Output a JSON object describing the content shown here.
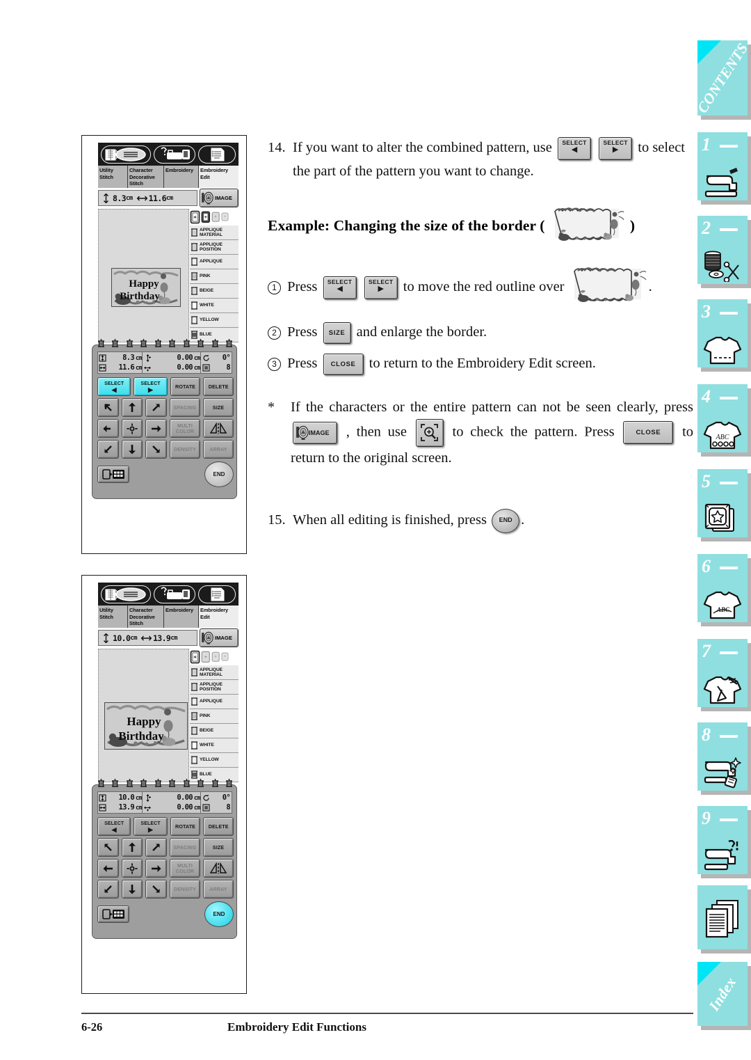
{
  "document": {
    "footer": {
      "page_number": "6-26",
      "section_title": "Embroidery Edit Functions"
    }
  },
  "body": {
    "step14": {
      "number": "14.",
      "text_before": "If you want to alter the combined pattern, use",
      "text_after": "to select the part of the pattern you want to change.",
      "button_left": {
        "label": "SELECT",
        "arrow": "◀"
      },
      "button_right": {
        "label": "SELECT",
        "arrow": "▶"
      }
    },
    "example_heading": {
      "text_before": "Example: Changing the size of the border (",
      "text_after": ")"
    },
    "substeps": [
      {
        "marker": "1",
        "text_before": "Press",
        "text_middle": "to move the red outline over",
        "text_after": ".",
        "button_left": {
          "label": "SELECT",
          "arrow": "◀"
        },
        "button_right": {
          "label": "SELECT",
          "arrow": "▶"
        }
      },
      {
        "marker": "2",
        "text_before": "Press",
        "text_after": "and enlarge the border.",
        "button": {
          "label": "SIZE"
        }
      },
      {
        "marker": "3",
        "text_before": "Press",
        "text_after": "to return to the Embroidery Edit screen.",
        "button": {
          "label": "CLOSE"
        }
      }
    ],
    "note": {
      "marker": "*",
      "line1": "If the characters or the entire pattern can not be seen clearly,",
      "seg_press": "press",
      "seg_then_use": ", then use",
      "seg_check": "to check the pattern. Press",
      "seg_return": "to return to the original screen.",
      "button_image": {
        "label": "IMAGE"
      },
      "button_zoom": {
        "label": "zoom-in"
      },
      "button_close": {
        "label": "CLOSE"
      }
    },
    "step15": {
      "number": "15.",
      "text_before": "When all editing is finished, press",
      "text_after": ".",
      "button": {
        "label": "END"
      }
    }
  },
  "screens": [
    {
      "id": "screen-before-resize",
      "icon_bar": [
        "stitch-chart-icon",
        "machine-help-icon",
        "settings-list-icon"
      ],
      "tabs": [
        {
          "label": "Utility Stitch",
          "active": false
        },
        {
          "label": "Character Decorative Stitch",
          "active": false
        },
        {
          "label": "Embroidery",
          "active": false
        },
        {
          "label": "Embroidery Edit",
          "active": true
        }
      ],
      "size_readout": {
        "height": "8.3",
        "width": "11.6",
        "unit": "cm"
      },
      "image_button": "IMAGE",
      "pattern_text": [
        "Happy",
        "Birthday"
      ],
      "hoop_selected_index": 0,
      "color_list": [
        "APPLIQUE MATERIAL",
        "APPLIQUE POSITION",
        "APPLIQUE",
        "PINK",
        "BEIGE",
        "WHITE",
        "YELLOW",
        "BLUE"
      ],
      "panel_readout": {
        "height": "8.3",
        "width": "11.6",
        "v_offset": "0.00",
        "h_offset": "0.00",
        "unit": "cm",
        "rotation": "0°",
        "color_count": "8"
      },
      "buttons": {
        "select_left": {
          "label": "SELECT",
          "arrow": "◀",
          "highlighted": true,
          "enabled": true
        },
        "select_right": {
          "label": "SELECT",
          "arrow": "▶",
          "highlighted": true,
          "enabled": true
        },
        "rotate": {
          "label": "ROTATE",
          "enabled": true
        },
        "delete": {
          "label": "DELETE",
          "enabled": true
        },
        "spacing": {
          "label": "SPACING",
          "enabled": false
        },
        "size": {
          "label": "SIZE",
          "enabled": true
        },
        "multi_color": {
          "label": "MULTI COLOR",
          "enabled": false
        },
        "mirror": {
          "label": "mirror-icon",
          "enabled": true
        },
        "density": {
          "label": "DENSITY",
          "enabled": false
        },
        "array": {
          "label": "ARRAY",
          "enabled": false
        },
        "layout": {
          "label": "hoop-layout-icon",
          "enabled": true
        },
        "end": {
          "label": "END",
          "highlighted": false
        }
      }
    },
    {
      "id": "screen-after-resize",
      "icon_bar": [
        "stitch-chart-icon",
        "machine-help-icon",
        "settings-list-icon"
      ],
      "tabs": [
        {
          "label": "Utility Stitch",
          "active": false
        },
        {
          "label": "Character Decorative Stitch",
          "active": false
        },
        {
          "label": "Embroidery",
          "active": false
        },
        {
          "label": "Embroidery Edit",
          "active": true
        }
      ],
      "size_readout": {
        "height": "10.0",
        "width": "13.9",
        "unit": "cm"
      },
      "image_button": "IMAGE",
      "pattern_text": [
        "Happy",
        "Birthday"
      ],
      "hoop_selected_index": 0,
      "color_list": [
        "APPLIQUE MATERIAL",
        "APPLIQUE POSITION",
        "APPLIQUE",
        "PINK",
        "BEIGE",
        "WHITE",
        "YELLOW",
        "BLUE"
      ],
      "panel_readout": {
        "height": "10.0",
        "width": "13.9",
        "v_offset": "0.00",
        "h_offset": "0.00",
        "unit": "cm",
        "rotation": "0°",
        "color_count": "8"
      },
      "buttons": {
        "select_left": {
          "label": "SELECT",
          "arrow": "◀",
          "highlighted": false,
          "enabled": true
        },
        "select_right": {
          "label": "SELECT",
          "arrow": "▶",
          "highlighted": false,
          "enabled": true
        },
        "rotate": {
          "label": "ROTATE",
          "enabled": true
        },
        "delete": {
          "label": "DELETE",
          "enabled": true
        },
        "spacing": {
          "label": "SPACING",
          "enabled": false
        },
        "size": {
          "label": "SIZE",
          "enabled": true
        },
        "multi_color": {
          "label": "MULTI COLOR",
          "enabled": false
        },
        "mirror": {
          "label": "mirror-icon",
          "enabled": true
        },
        "density": {
          "label": "DENSITY",
          "enabled": false
        },
        "array": {
          "label": "ARRAY",
          "enabled": false
        },
        "layout": {
          "label": "hoop-layout-icon",
          "enabled": true
        },
        "end": {
          "label": "END",
          "highlighted": true
        }
      }
    }
  ],
  "sidebar": {
    "accent_color": "#8fdfe0",
    "corner_color": "#00e5f5",
    "tabs": [
      {
        "type": "word",
        "label": "CONTENTS",
        "icon": null
      },
      {
        "type": "numbered",
        "label": "1",
        "icon": "sewing-machine-icon"
      },
      {
        "type": "numbered",
        "label": "2",
        "icon": "spool-scissors-icon"
      },
      {
        "type": "numbered",
        "label": "3",
        "icon": "tshirt-stitch-icon"
      },
      {
        "type": "numbered",
        "label": "4",
        "icon": "tshirt-abc-icon"
      },
      {
        "type": "numbered",
        "label": "5",
        "icon": "embroidery-card-icon"
      },
      {
        "type": "numbered",
        "label": "6",
        "icon": "tshirt-monogram-icon"
      },
      {
        "type": "numbered",
        "label": "7",
        "icon": "tshirt-needle-icon"
      },
      {
        "type": "numbered",
        "label": "8",
        "icon": "machine-clean-icon"
      },
      {
        "type": "numbered",
        "label": "9",
        "icon": "machine-question-icon"
      },
      {
        "type": "plain",
        "label": "",
        "icon": "pages-icon"
      },
      {
        "type": "word",
        "label": "Index",
        "icon": null
      }
    ]
  }
}
